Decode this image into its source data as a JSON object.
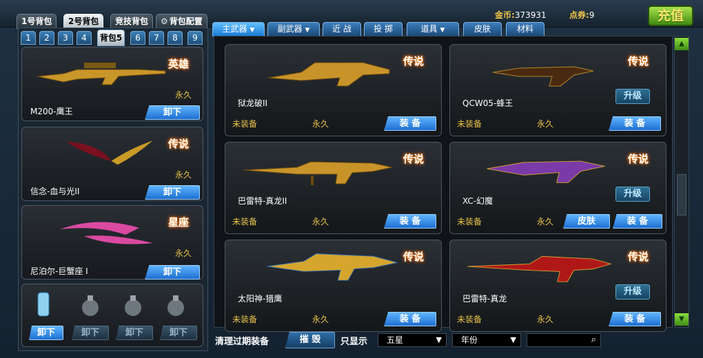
{
  "bag_tabs": [
    "1号背包",
    "2号背包",
    "竞技背包",
    "背包配置"
  ],
  "currency": {
    "gold_label": "金币:",
    "gold_value": "373931",
    "points_label": "点券:",
    "points_value": "9"
  },
  "charge_label": "充值",
  "pack_tabs": [
    "1",
    "2",
    "3",
    "4",
    "背包5",
    "6",
    "7",
    "8",
    "9"
  ],
  "left_items": [
    {
      "name": "M200-鹰王",
      "rank": "英雄",
      "duration": "永久",
      "action": "卸下"
    },
    {
      "name": "信念-血与光II",
      "rank": "传说",
      "duration": "永久",
      "action": "卸下"
    },
    {
      "name": "尼泊尔-巨蟹座 I",
      "rank": "星座",
      "duration": "永久",
      "action": "卸下"
    }
  ],
  "grenade_actions": [
    "卸下",
    "卸下",
    "卸下",
    "卸下"
  ],
  "category_tabs": [
    "主武器",
    "副武器",
    "近 战",
    "投 掷",
    "道具",
    "皮肤",
    "材料"
  ],
  "weapons": [
    {
      "name": "狱龙破II",
      "rank": "传说",
      "status": "未装备",
      "duration": "永久",
      "action": "装 备"
    },
    {
      "name": "QCW05-蜂王",
      "rank": "传说",
      "status": "未装备",
      "duration": "永久",
      "action": "装 备",
      "upgrade": "升级"
    },
    {
      "name": "巴雷特-真龙II",
      "rank": "传说",
      "status": "未装备",
      "duration": "永久",
      "action": "装 备"
    },
    {
      "name": "XC-幻魔",
      "rank": "传说",
      "status": "未装备",
      "duration": "永久",
      "action": "装 备",
      "upgrade": "升级",
      "skin": "皮肤"
    },
    {
      "name": "太阳神-猎鹰",
      "rank": "传说",
      "status": "未装备",
      "duration": "永久",
      "action": "装 备"
    },
    {
      "name": "巴雷特-真龙",
      "rank": "传说",
      "status": "未装备",
      "duration": "永久",
      "action": "装 备",
      "upgrade": "升级"
    }
  ],
  "bottom": {
    "clear_label": "清理过期装备",
    "destroy_label": "摧 毁",
    "filter_label": "只显示",
    "filter1": "五星",
    "filter2": "年份",
    "search_value": ""
  },
  "colors": {
    "gold": "#f0c64a",
    "charge": "#8ccf2e",
    "active_tab": "#1a7cd6"
  },
  "icons": [
    "gear-icon",
    "search-icon",
    "dropdown-arrow-icon",
    "scroll-up-icon",
    "scroll-down-icon",
    "grenade-icon",
    "knife-icon",
    "rifle-icon"
  ]
}
